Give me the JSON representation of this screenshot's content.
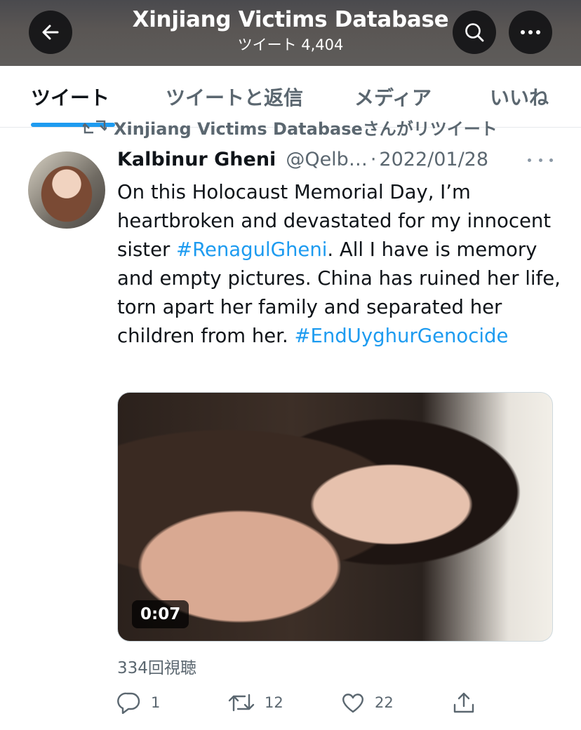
{
  "header": {
    "title": "Xinjiang Victims Database",
    "subtitle": "ツイート 4,404",
    "back_icon": "back-arrow-icon",
    "search_icon": "search-icon",
    "more_icon": "more-horizontal-icon"
  },
  "tabs": [
    {
      "label": "ツイート",
      "active": true
    },
    {
      "label": "ツイートと返信",
      "active": false
    },
    {
      "label": "メディア",
      "active": false
    },
    {
      "label": "いいね",
      "active": false
    }
  ],
  "tweet": {
    "retweet_context": "Xinjiang Victims Databaseさんがリツイート",
    "author_name": "Kalbinur Gheni",
    "handle": "@Qelb…",
    "separator": "·",
    "date": "2022/01/28",
    "text_parts": {
      "p1": "On this Holocaust Memorial Day, I’m heartbroken and devastated for my innocent sister ",
      "hashtag1": "#RenagulGheni",
      "p2": ". All I have is memory and empty pictures. China has ruined her life, torn apart her family and separated her children from her. ",
      "hashtag2": "#EndUyghurGenocide"
    },
    "media": {
      "duration": "0:07"
    },
    "views": "334回視聴",
    "actions": {
      "reply_count": "1",
      "retweet_count": "12",
      "like_count": "22"
    }
  },
  "colors": {
    "accent": "#1d9bf0",
    "secondary_text": "#5b6770",
    "primary_text": "#0f1419"
  }
}
